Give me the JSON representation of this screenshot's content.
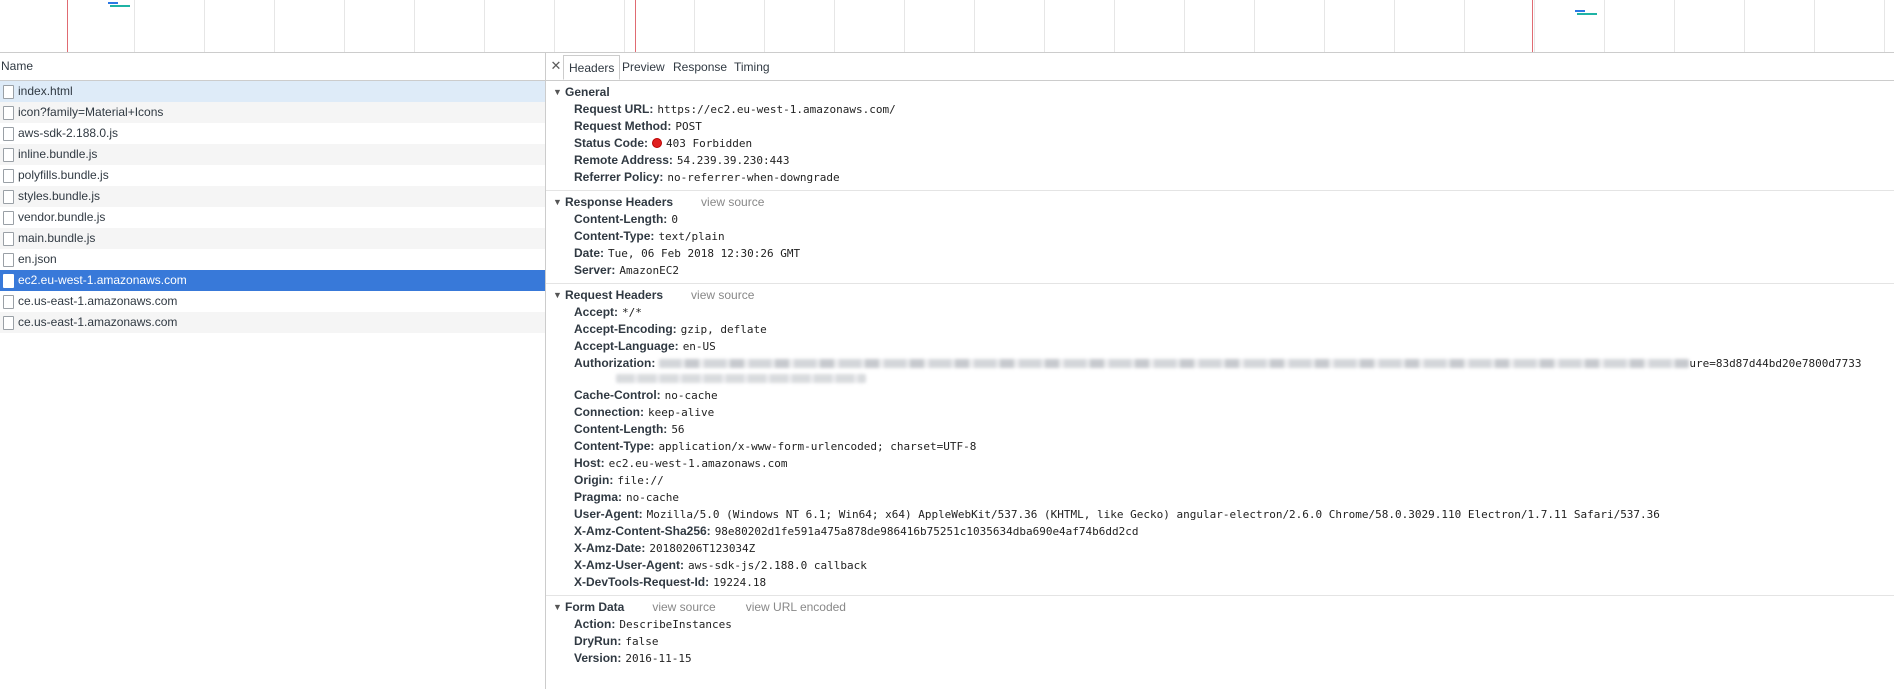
{
  "colors": {
    "selected_row": "#3879d9",
    "first_row": "#deebf8",
    "status_error": "#e02020",
    "waterfall_red_line": "#e06b72",
    "waterfall_blue": "#2b78e4",
    "waterfall_teal": "#1fb3a5"
  },
  "network_list": {
    "column_header": "Name",
    "rows": [
      {
        "name": "index.html",
        "icon": "file-icon"
      },
      {
        "name": "icon?family=Material+Icons",
        "icon": "file-icon"
      },
      {
        "name": "aws-sdk-2.188.0.js",
        "icon": "file-icon"
      },
      {
        "name": "inline.bundle.js",
        "icon": "file-icon"
      },
      {
        "name": "polyfills.bundle.js",
        "icon": "file-icon"
      },
      {
        "name": "styles.bundle.js",
        "icon": "file-icon"
      },
      {
        "name": "vendor.bundle.js",
        "icon": "file-icon"
      },
      {
        "name": "main.bundle.js",
        "icon": "file-icon"
      },
      {
        "name": "en.json",
        "icon": "file-icon"
      },
      {
        "name": "ec2.eu-west-1.amazonaws.com",
        "icon": "file-icon",
        "selected": true
      },
      {
        "name": "ce.us-east-1.amazonaws.com",
        "icon": "file-icon"
      },
      {
        "name": "ce.us-east-1.amazonaws.com",
        "icon": "file-icon"
      }
    ]
  },
  "detail": {
    "close_icon": "close-icon",
    "tabs": [
      "Headers",
      "Preview",
      "Response",
      "Timing"
    ],
    "active_tab": "Headers",
    "general": {
      "title": "General",
      "request_url_label": "Request URL:",
      "request_url": "https://ec2.eu-west-1.amazonaws.com/",
      "request_method_label": "Request Method:",
      "request_method": "POST",
      "status_code_label": "Status Code:",
      "status_code": "403 Forbidden",
      "remote_address_label": "Remote Address:",
      "remote_address": "54.239.39.230:443",
      "referrer_policy_label": "Referrer Policy:",
      "referrer_policy": "no-referrer-when-downgrade"
    },
    "response_headers": {
      "title": "Response Headers",
      "view_source": "view source",
      "items": [
        {
          "key": "Content-Length:",
          "value": "0"
        },
        {
          "key": "Content-Type:",
          "value": "text/plain"
        },
        {
          "key": "Date:",
          "value": "Tue, 06 Feb 2018 12:30:26 GMT"
        },
        {
          "key": "Server:",
          "value": "AmazonEC2"
        }
      ]
    },
    "request_headers": {
      "title": "Request Headers",
      "view_source": "view source",
      "accept_label": "Accept:",
      "accept": "*/*",
      "accept_encoding_label": "Accept-Encoding:",
      "accept_encoding": "gzip, deflate",
      "accept_language_label": "Accept-Language:",
      "accept_language": "en-US",
      "authorization_label": "Authorization:",
      "authorization_visible_tail": "ure=83d87d44bd20e7800d7733",
      "items_after": [
        {
          "key": "Cache-Control:",
          "value": "no-cache"
        },
        {
          "key": "Connection:",
          "value": "keep-alive"
        },
        {
          "key": "Content-Length:",
          "value": "56"
        },
        {
          "key": "Content-Type:",
          "value": "application/x-www-form-urlencoded; charset=UTF-8"
        },
        {
          "key": "Host:",
          "value": "ec2.eu-west-1.amazonaws.com"
        },
        {
          "key": "Origin:",
          "value": "file://"
        },
        {
          "key": "Pragma:",
          "value": "no-cache"
        },
        {
          "key": "User-Agent:",
          "value": "Mozilla/5.0 (Windows NT 6.1; Win64; x64) AppleWebKit/537.36 (KHTML, like Gecko) angular-electron/2.6.0 Chrome/58.0.3029.110 Electron/1.7.11 Safari/537.36"
        },
        {
          "key": "X-Amz-Content-Sha256:",
          "value": "98e80202d1fe591a475a878de986416b75251c1035634dba690e4af74b6dd2cd"
        },
        {
          "key": "X-Amz-Date:",
          "value": "20180206T123034Z"
        },
        {
          "key": "X-Amz-User-Agent:",
          "value": "aws-sdk-js/2.188.0 callback"
        },
        {
          "key": "X-DevTools-Request-Id:",
          "value": "19224.18"
        }
      ]
    },
    "form_data": {
      "title": "Form Data",
      "view_source": "view source",
      "view_url_encoded": "view URL encoded",
      "items": [
        {
          "key": "Action:",
          "value": "DescribeInstances"
        },
        {
          "key": "DryRun:",
          "value": "false"
        },
        {
          "key": "Version:",
          "value": "2016-11-15"
        }
      ]
    }
  }
}
